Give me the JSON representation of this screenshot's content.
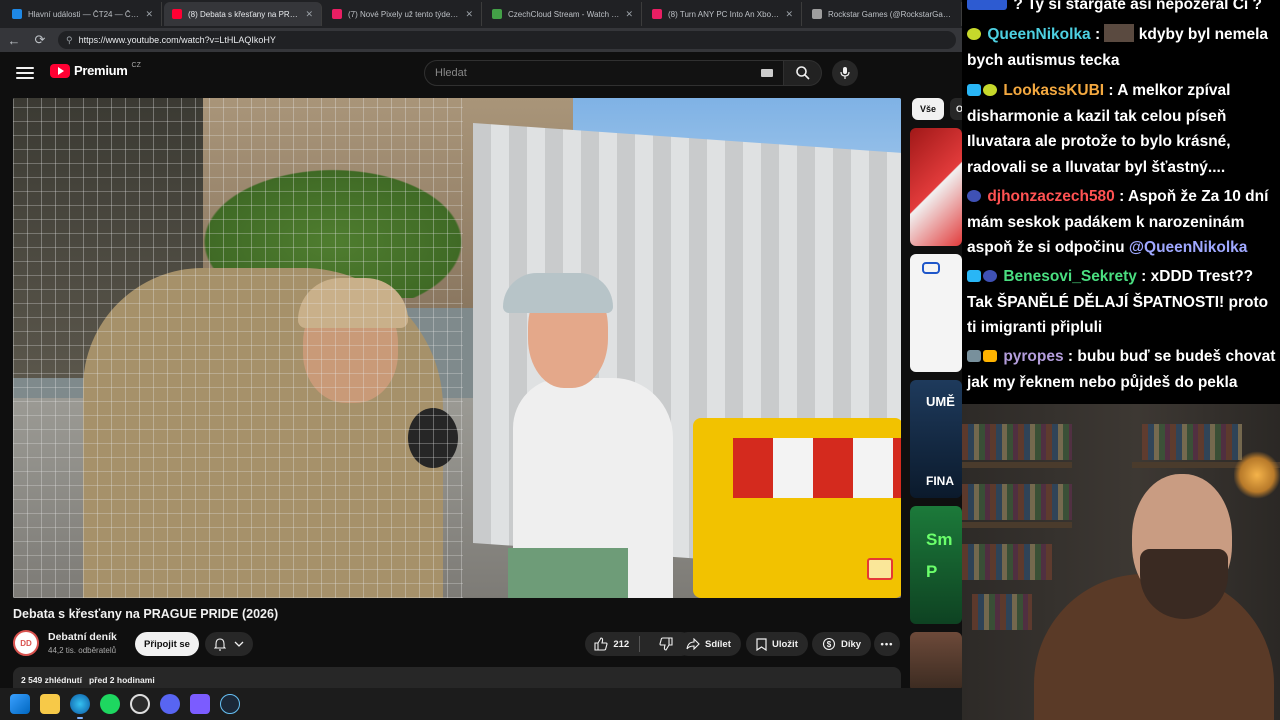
{
  "browser": {
    "tabs": [
      {
        "label": "Hlavní události — ČT24 — Česká",
        "favicon_color": "#1e88e5",
        "active": false
      },
      {
        "label": "(8) Debata s křesťany na PRAGUE",
        "favicon_color": "#ff0033",
        "active": true
      },
      {
        "label": "(7) Nové Pixely už tento týden. |",
        "favicon_color": "#e91e63",
        "active": false
      },
      {
        "label": "CzechCloud Stream - Watch Live o",
        "favicon_color": "#43a047",
        "active": false
      },
      {
        "label": "(8) Turn ANY PC Into An Xbox! Hi",
        "favicon_color": "#e91e63",
        "active": false
      },
      {
        "label": "Rockstar Games (@RockstarGame",
        "favicon_color": "#9e9e9e",
        "active": false
      }
    ],
    "url": "https://www.youtube.com/watch?v=LtHLAQIkoHY"
  },
  "youtube": {
    "brand": "Premium",
    "country": "CZ",
    "search_placeholder": "Hledat",
    "video_title": "Debata s křesťany na PRAGUE PRIDE (2026)",
    "channel": {
      "name": "Debatní deník",
      "subscribers": "44,2 tis. odběratelů",
      "avatar_text": "DD"
    },
    "join_label": "Připojit se",
    "like_count": "212",
    "share_label": "Sdílet",
    "save_label": "Uložit",
    "thanks_label": "Díky",
    "views": "2 549 zhlédnutí",
    "posted": "před 2 hodinami",
    "chips": [
      "Vše",
      "O"
    ],
    "rail_labels": [
      "UMĚ",
      "FINA",
      "Sm",
      "P"
    ]
  },
  "taskbar": {
    "icons": [
      "windows-start-icon",
      "file-explorer-icon",
      "edge-icon",
      "spotify-icon",
      "obs-icon",
      "discord-icon",
      "app-grid-icon",
      "steam-icon"
    ]
  },
  "chat": {
    "top_text": "? Ty si stargate asi nepozeral Či ?",
    "messages": [
      {
        "user": "QueenNikolka",
        "color": "#4dd0e1",
        "text": "kdyby byl nemela bych autismus tecka"
      },
      {
        "user": "LookassKUBI",
        "color": "#f4a940",
        "text": "A melkor zpíval disharmonie a kazil tak celou píseň Iluvatara ale protože to bylo krásné, radovali se a Iluvatar byl šťastný...."
      },
      {
        "user": "djhonzaczech580",
        "color": "#ff5252",
        "text": "Aspoň že Za 10 dní mám seskok padákem k narozeninám aspoň že si odpočinu",
        "mention": "@QueenNikolka"
      },
      {
        "user": "Benesovi_Sekrety",
        "color": "#4ade80",
        "text": "xDDD Trest?? Tak ŠPANĚLÉ DĚLAJÍ ŠPATNOSTI! proto ti imigranti připluli"
      },
      {
        "user": "pyropes",
        "color": "#b39ddb",
        "text": "bubu buď se budeš chovat jak my řeknem nebo půjdeš do pekla"
      }
    ]
  }
}
